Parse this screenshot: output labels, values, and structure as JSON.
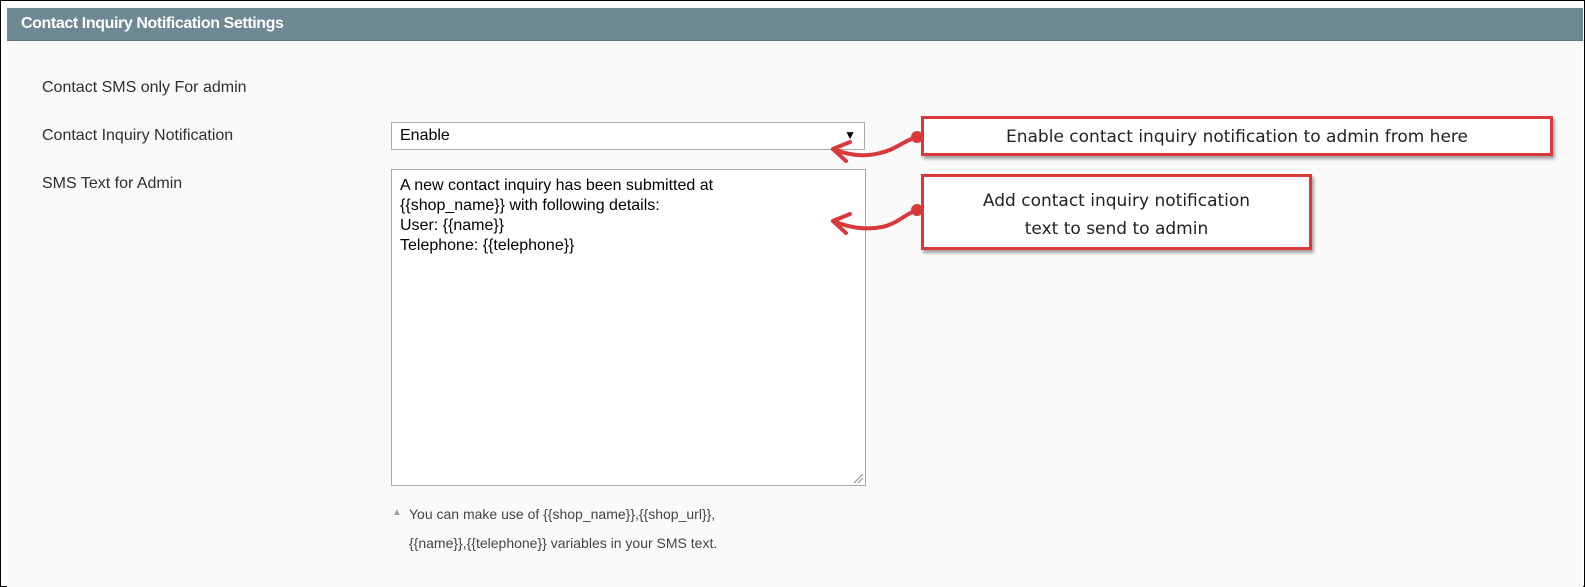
{
  "header": {
    "title": "Contact Inquiry Notification Settings"
  },
  "form": {
    "section_label": "Contact SMS only For admin",
    "notification_label": "Contact Inquiry Notification",
    "notification_value": "Enable",
    "sms_label": "SMS Text for Admin",
    "sms_text": "A new contact inquiry has been submitted at\n{{shop_name}} with following details:\nUser: {{name}}\nTelephone: {{telephone}}",
    "note_line1": "You can make use of {{shop_name}},{{shop_url}},",
    "note_line2": "{{name}},{{telephone}} variables in your SMS text."
  },
  "annotations": {
    "callout1": "Enable contact inquiry notification to admin from here",
    "callout2_line1": "Add contact inquiry notification",
    "callout2_line2": "text to send to admin"
  },
  "colors": {
    "header_bg": "#6f8992",
    "callout_border": "#d9393a",
    "arrow": "#d9393a"
  },
  "icons": {
    "dropdown": "caret-down-icon",
    "note": "triangle-up-icon",
    "resize": "resize-grip-icon"
  }
}
